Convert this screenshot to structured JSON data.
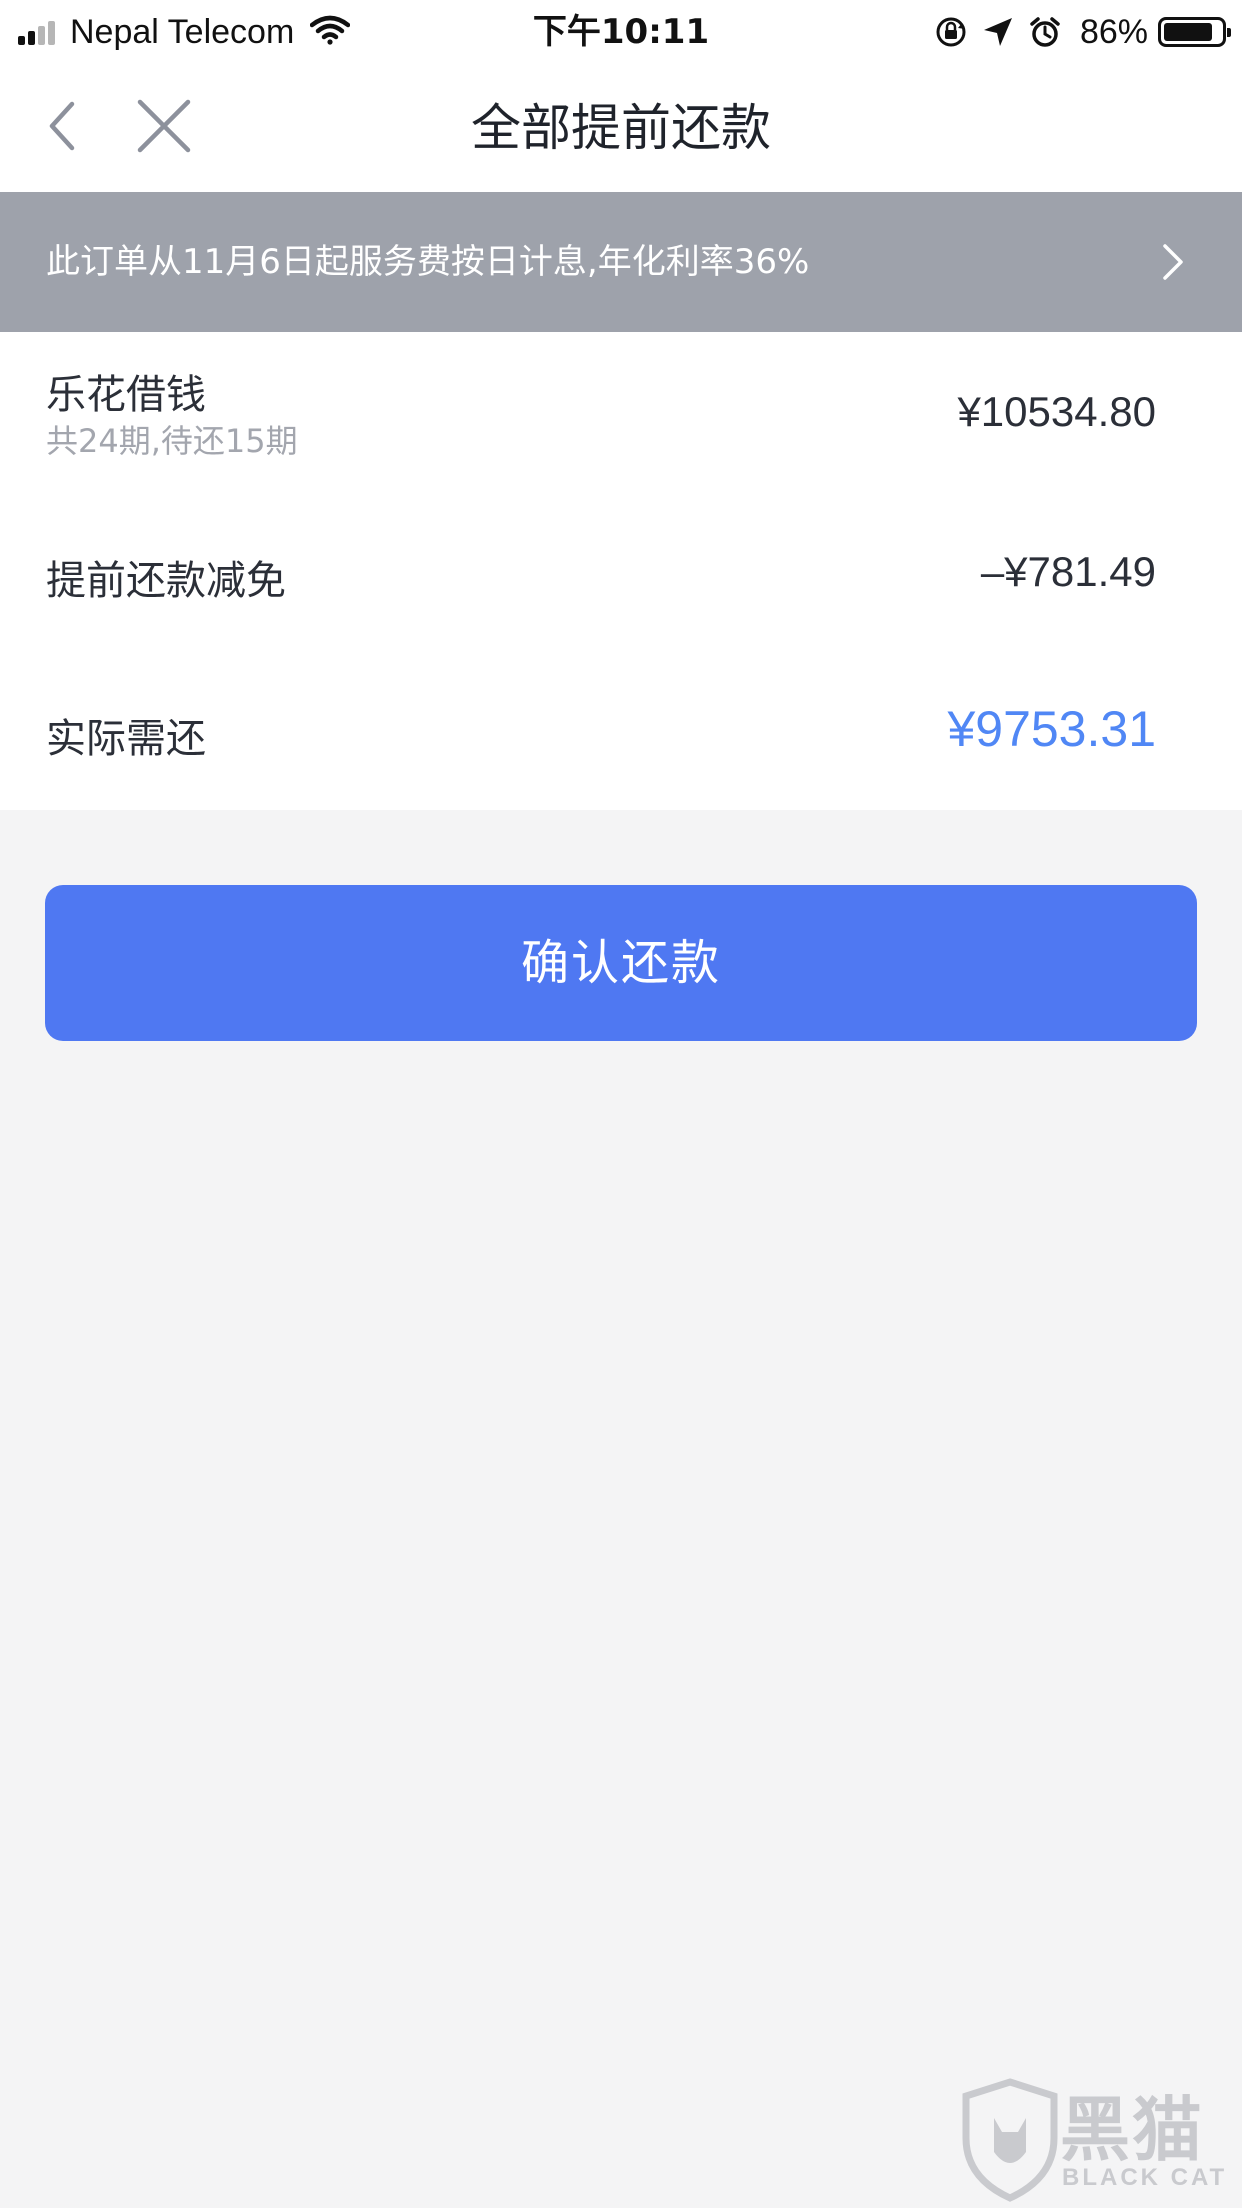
{
  "status_bar": {
    "carrier": "Nepal Telecom",
    "time": "下午10:11",
    "battery": "86%",
    "battery_level": 0.86,
    "icons": [
      "signal-icon",
      "wifi-icon",
      "rotation-lock-icon",
      "location-icon",
      "alarm-icon",
      "battery-icon"
    ]
  },
  "nav": {
    "title": "全部提前还款",
    "back_icon": "chevron-left-icon",
    "close_icon": "close-icon"
  },
  "notice": {
    "text": "此订单从11月6日起服务费按日计息,年化利率36%",
    "arrow_icon": "chevron-right-icon"
  },
  "summary": {
    "loan_name": "乐花借钱",
    "loan_periods": "共24期,待还15期",
    "loan_amount": "¥10534.80",
    "discount_label": "提前还款减免",
    "discount_amount": "–¥781.49",
    "actual_label": "实际需还",
    "actual_amount": "¥9753.31"
  },
  "actions": {
    "confirm_label": "确认还款"
  },
  "watermark": {
    "brand": "黑猫",
    "brand_en": "BLACK CAT"
  },
  "colors": {
    "accent": "#5087f5",
    "button": "#4f78f2",
    "notice_bg": "#9ea2ab",
    "page_bg": "#f4f4f5"
  }
}
